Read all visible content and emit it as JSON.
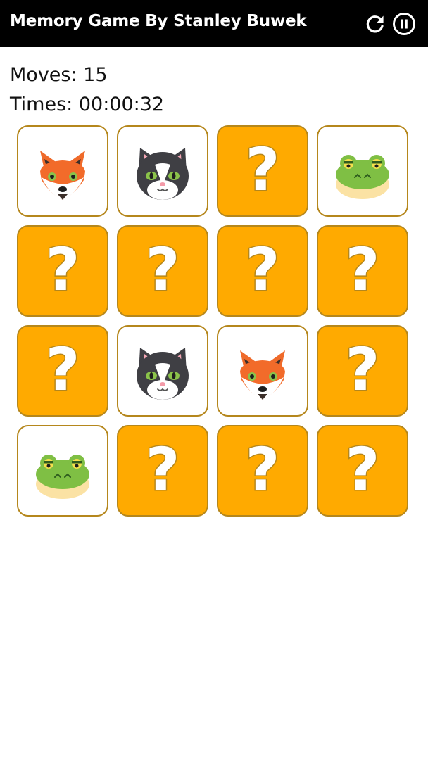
{
  "header": {
    "title": "Memory Game By Stanley Buwek",
    "restart_icon": "restart-icon",
    "pause_icon": "pause-icon"
  },
  "stats": {
    "moves_label": "Moves:",
    "moves": "15",
    "time_label": "Times:",
    "time": "00:00:32"
  },
  "board": {
    "rows": 4,
    "columns": 4,
    "hidden_card_symbol": "?",
    "cards": [
      {
        "state": "revealed",
        "animal": "fox"
      },
      {
        "state": "revealed",
        "animal": "cat"
      },
      {
        "state": "hidden",
        "animal": ""
      },
      {
        "state": "revealed",
        "animal": "frog"
      },
      {
        "state": "hidden",
        "animal": ""
      },
      {
        "state": "hidden",
        "animal": ""
      },
      {
        "state": "hidden",
        "animal": ""
      },
      {
        "state": "hidden",
        "animal": ""
      },
      {
        "state": "hidden",
        "animal": ""
      },
      {
        "state": "revealed",
        "animal": "cat"
      },
      {
        "state": "revealed",
        "animal": "fox"
      },
      {
        "state": "hidden",
        "animal": ""
      },
      {
        "state": "revealed",
        "animal": "frog"
      },
      {
        "state": "hidden",
        "animal": ""
      },
      {
        "state": "hidden",
        "animal": ""
      },
      {
        "state": "hidden",
        "animal": ""
      }
    ]
  },
  "colors": {
    "header_bg": "#000000",
    "card_back": "#ffaa00",
    "card_border": "#b5871c",
    "card_front": "#ffffff"
  }
}
